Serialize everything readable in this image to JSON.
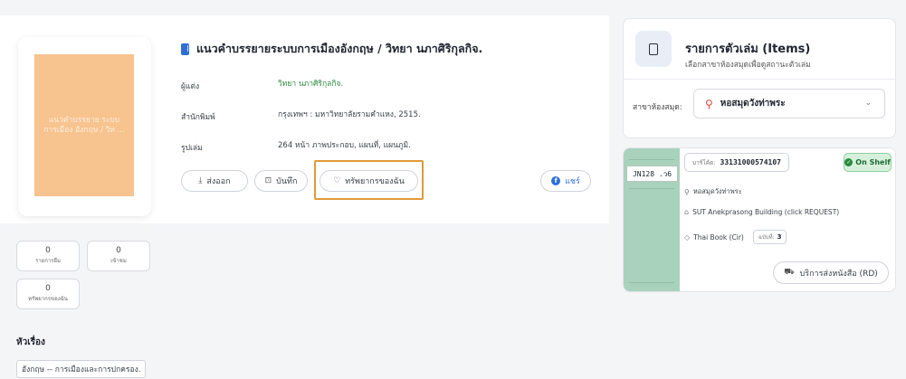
{
  "book": {
    "cover_text": "แนวคำบรรยาย ระบบการเมือง อังกฤษ / วิท ...",
    "title": "แนวคำบรรยายระบบการเมืองอังกฤษ / วิทยา นภาศิริกุลกิจ.",
    "author_label": "ผู้แต่ง",
    "author": "วิทยา นภาศิริกุลกิจ.",
    "publisher_label": "สำนักพิมพ์",
    "publisher": "กรุงเทพฯ : มหาวิทยาลัยรามคำแหง, 2515.",
    "format_label": "รูปเล่ม",
    "format": "264 หน้า ภาพประกอบ, แผนที่, แผนภูมิ."
  },
  "actions": {
    "export_label": "ส่งออก",
    "save_label": "บันทึก",
    "favorite_label": "ทรัพยากรของฉัน",
    "share_label": "แชร์",
    "share_icon": "f"
  },
  "stats": {
    "borrow_count": "0",
    "borrow_label": "รายการยืม",
    "views_count": "0",
    "views_label": "เข้าชม",
    "favorites_count": "0",
    "favorites_label": "ทรัพยากรของฉัน"
  },
  "subjects": {
    "heading": "หัวเรื่อง",
    "items": [
      "อังกฤษ -- การเมืองและการปกครอง."
    ]
  },
  "items_panel": {
    "title": "รายการตัวเล่ม (Items)",
    "subtitle": "เลือกสาขาห้องสมุดเพื่อดูสถานะตัวเล่ม",
    "branch_label": "สาขาห้องสมุด:",
    "branch_value": "หอสมุดวังท่าพระ"
  },
  "copy": {
    "call_number": "JN128 .ว6",
    "barcode_label": "บาร์โค้ด:",
    "barcode": "33131000574107",
    "status": "On Shelf",
    "status_color": "#2c8a3e",
    "location": "หอสมุดวังท่าพระ",
    "building": "SUT Anekprasong Building (click REQUEST)",
    "item_type": "Thai Book (Cir)",
    "copies_label": "ฉบับที่:",
    "copies": "3",
    "delivery_label": "บริการส่งหนังสือ (RD)"
  }
}
